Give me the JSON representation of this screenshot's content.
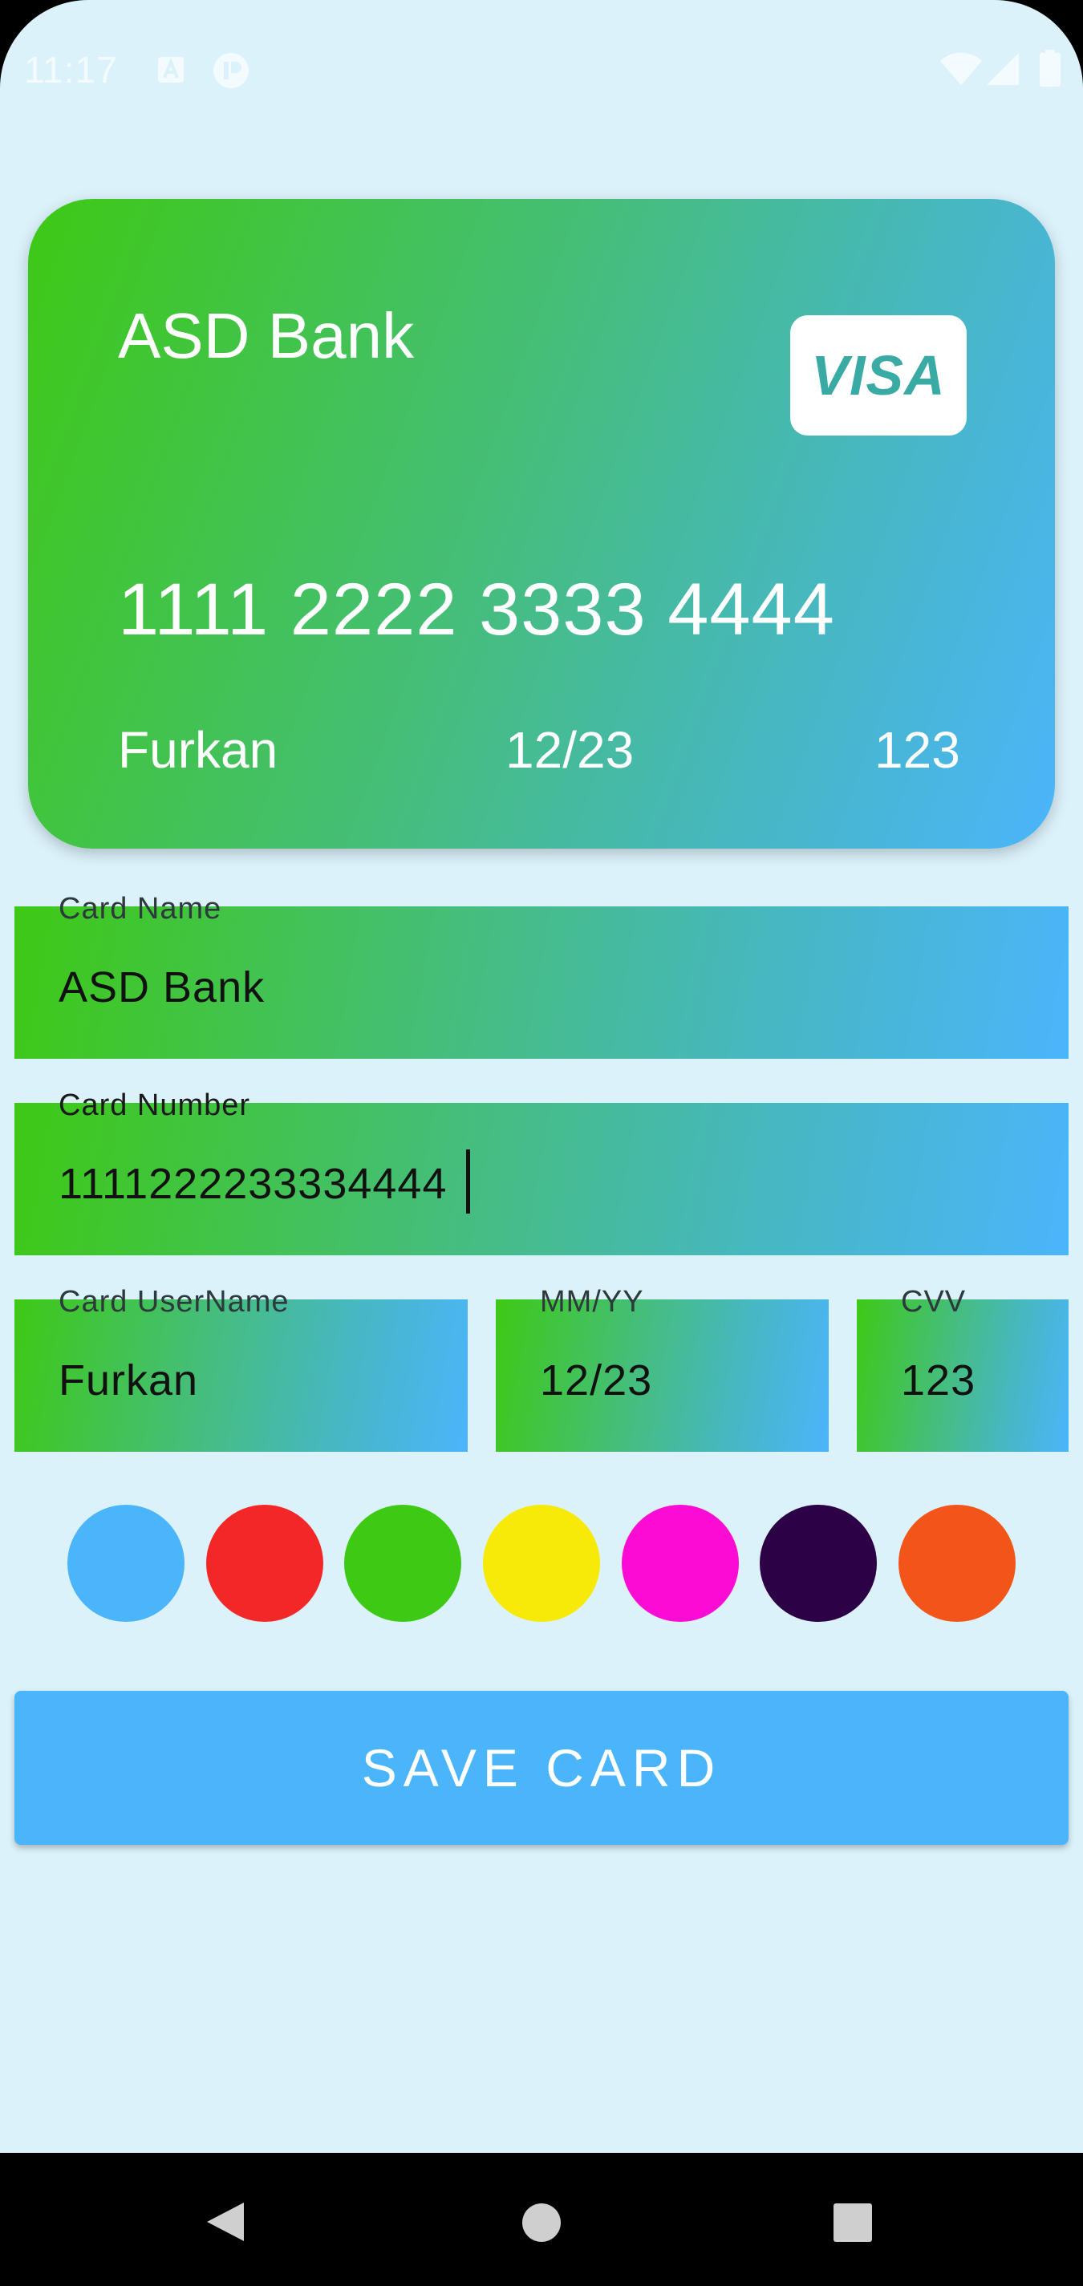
{
  "status_bar": {
    "time": "11:17",
    "icons": [
      "a-notification-icon",
      "play-notification-icon",
      "wifi-icon",
      "signal-icon",
      "battery-icon"
    ]
  },
  "card_preview": {
    "bank_name": "ASD Bank",
    "number": "1111 2222 3333 4444",
    "holder": "Furkan",
    "expiry": "12/23",
    "cvv": "123",
    "brand_logo": "VISA"
  },
  "form": {
    "card_name": {
      "label": "Card Name",
      "value": "ASD Bank"
    },
    "card_number": {
      "label": "Card Number",
      "value": "1111222233334444"
    },
    "card_username": {
      "label": "Card UserName",
      "value": "Furkan"
    },
    "expiry": {
      "label": "MM/YY",
      "value": "12/23"
    },
    "cvv": {
      "label": "CVV",
      "value": "123"
    }
  },
  "color_options": [
    "#4ab5fb",
    "#f32727",
    "#3ec915",
    "#f7ea09",
    "#fb0bd4",
    "#2c0145",
    "#f2541a"
  ],
  "save_button": {
    "label": "SAVE CARD"
  },
  "nav_bar": {
    "buttons": [
      "back-icon",
      "home-icon",
      "recents-icon"
    ]
  },
  "colors": {
    "background": "#dcf2fb",
    "gradient_start": "#3ec915",
    "gradient_end": "#4ab5fb",
    "accent": "#4ab5fb"
  }
}
